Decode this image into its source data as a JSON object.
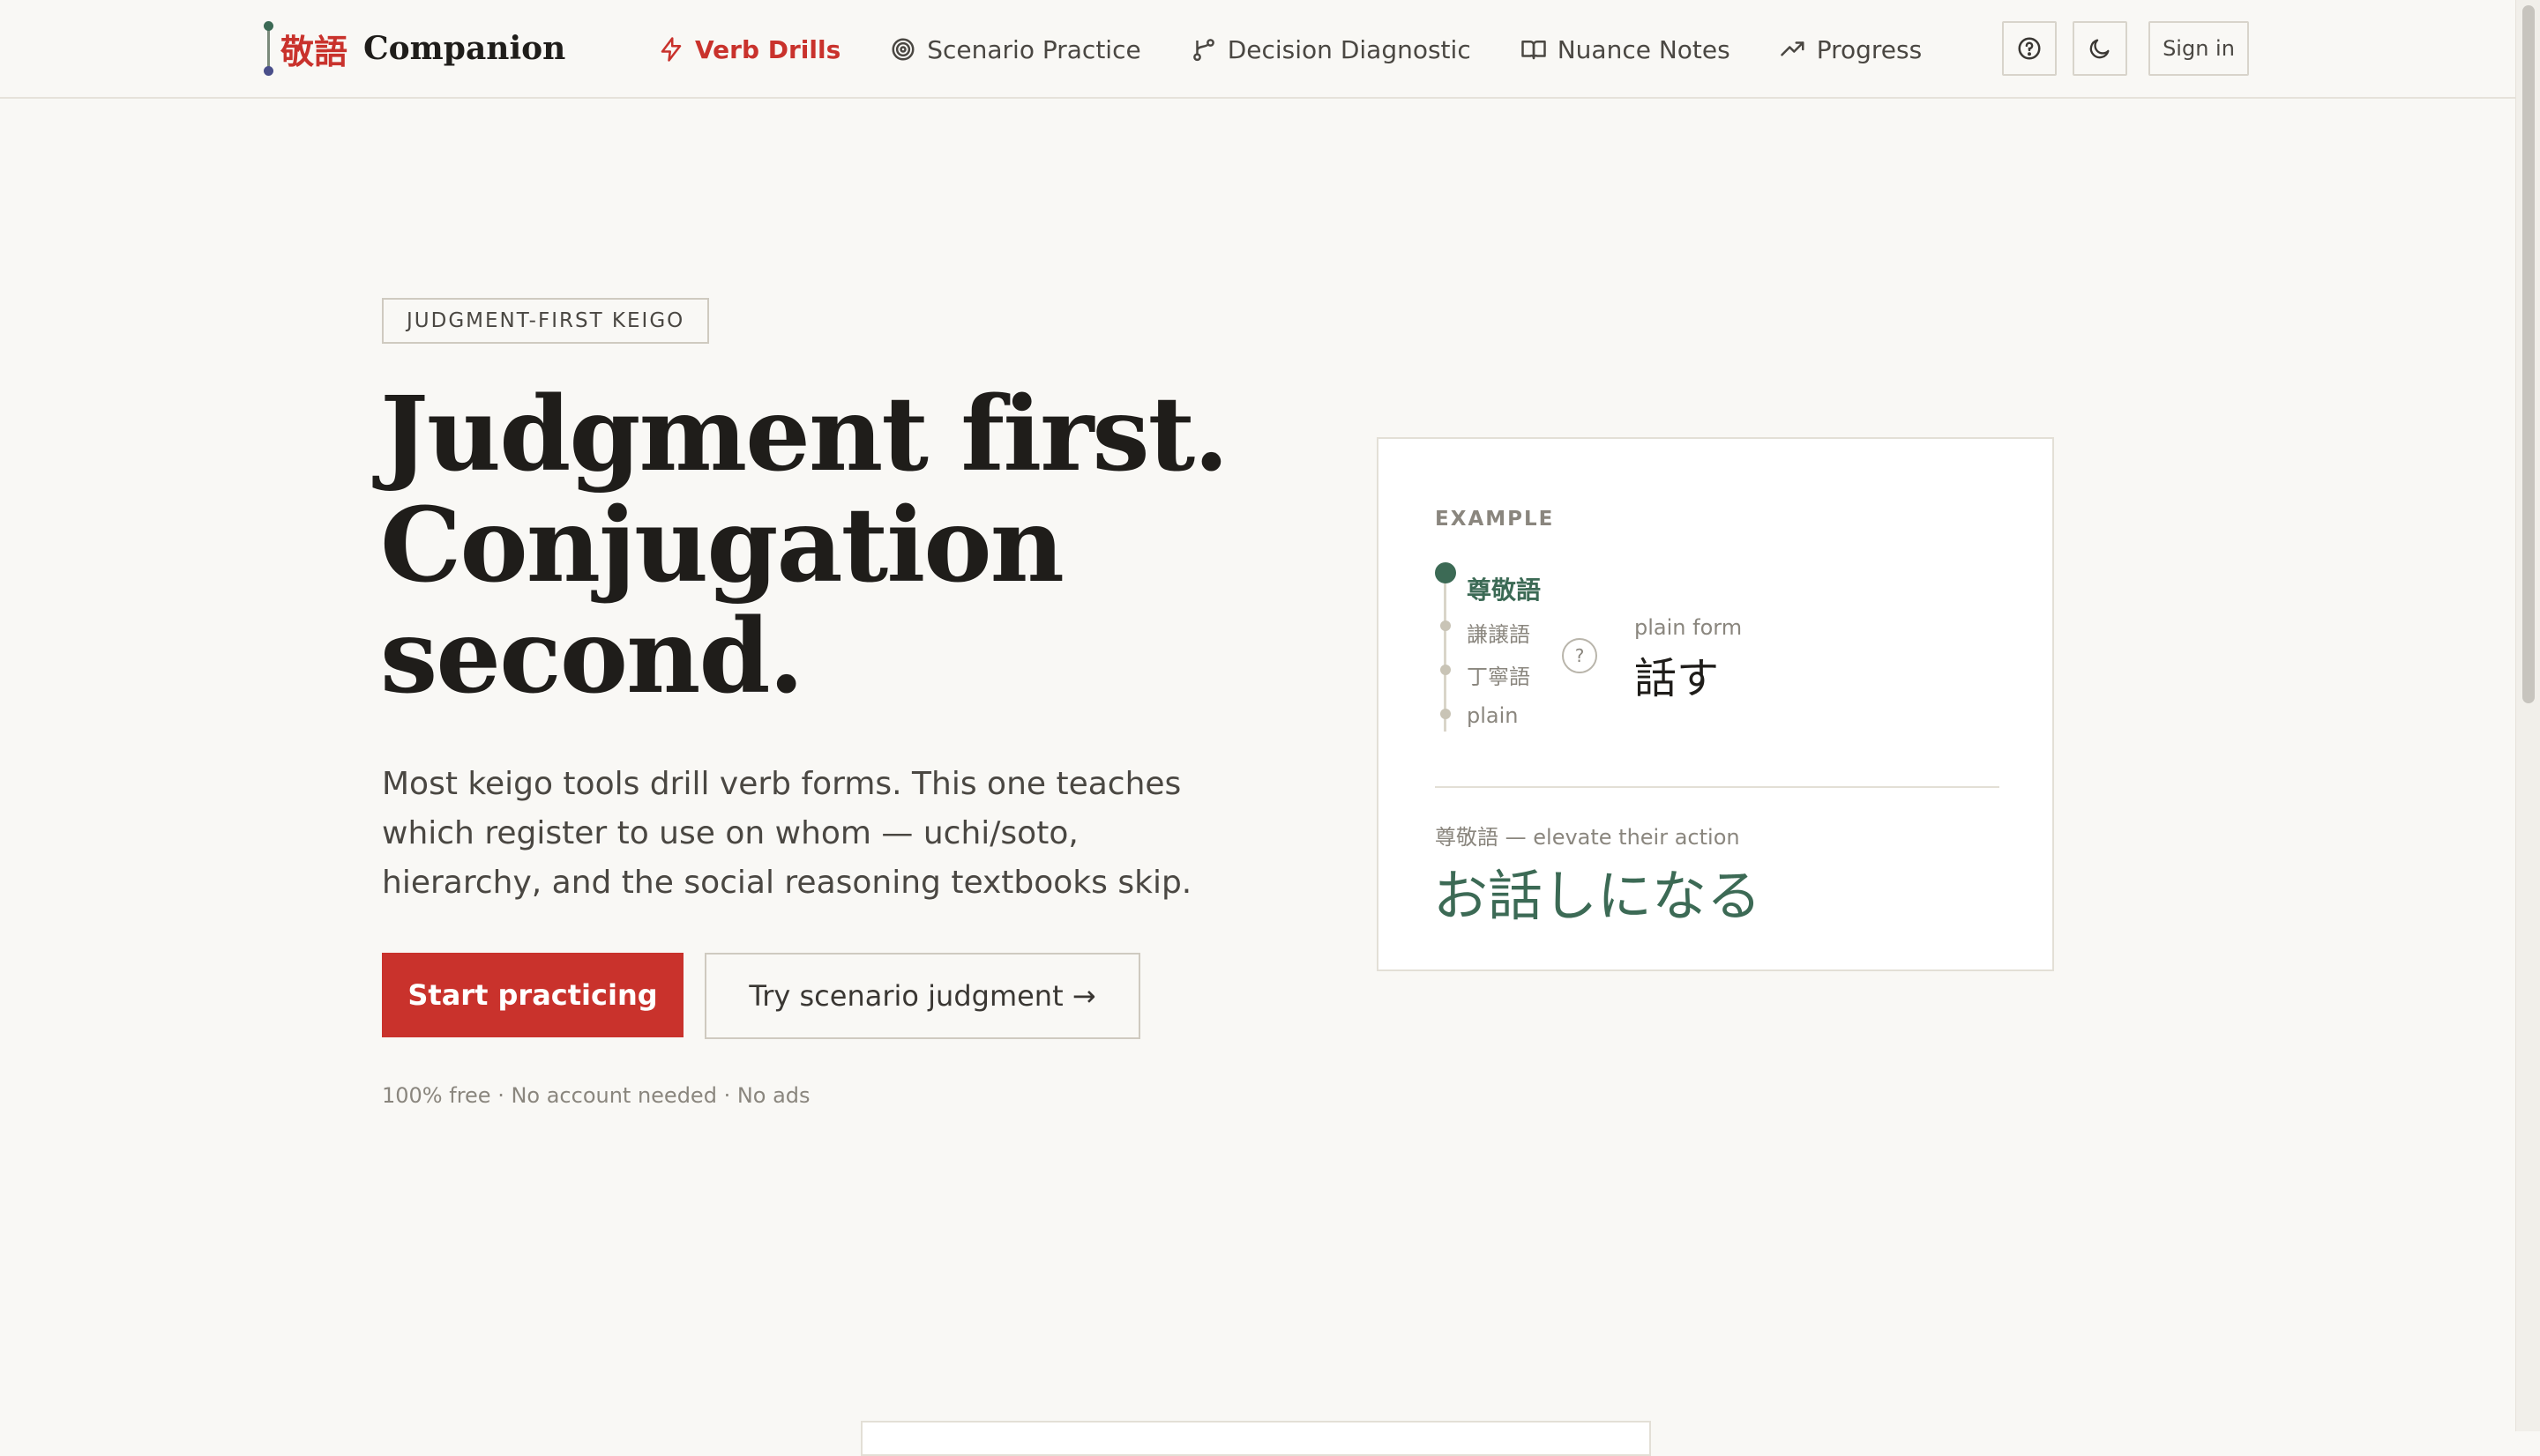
{
  "brand": {
    "kanji": "敬語",
    "name": "Companion"
  },
  "nav": {
    "items": [
      {
        "label": "Verb Drills",
        "icon": "bolt-icon",
        "active": true
      },
      {
        "label": "Scenario Practice",
        "icon": "target-icon",
        "active": false
      },
      {
        "label": "Decision Diagnostic",
        "icon": "branch-icon",
        "active": false
      },
      {
        "label": "Nuance Notes",
        "icon": "book-icon",
        "active": false
      },
      {
        "label": "Progress",
        "icon": "trend-up-icon",
        "active": false
      }
    ]
  },
  "header_tools": {
    "help_icon": "help-circle-icon",
    "theme_icon": "moon-icon",
    "signin_label": "Sign in"
  },
  "hero": {
    "eyebrow": "JUDGMENT-FIRST KEIGO",
    "title_lines": [
      "Judgment first.",
      "Conjugation",
      "second."
    ],
    "subtitle": "Most keigo tools drill verb forms. This one teaches which register to use on whom — uchi/soto, hierarchy, and the social reasoning textbooks skip.",
    "primary_cta": "Start practicing",
    "secondary_cta": "Try scenario judgment →",
    "fine_print": "100% free · No account needed · No ads"
  },
  "example": {
    "label": "EXAMPLE",
    "levels": [
      "尊敬語",
      "謙譲語",
      "丁寧語",
      "plain"
    ],
    "question_mark": "?",
    "plain_label": "plain form",
    "plain_value": "話す",
    "result_label": "尊敬語 — elevate their action",
    "result_value": "お話しになる"
  },
  "colors": {
    "accent_red": "#c9322c",
    "accent_green": "#3c6a55",
    "background": "#f9f8f5"
  }
}
